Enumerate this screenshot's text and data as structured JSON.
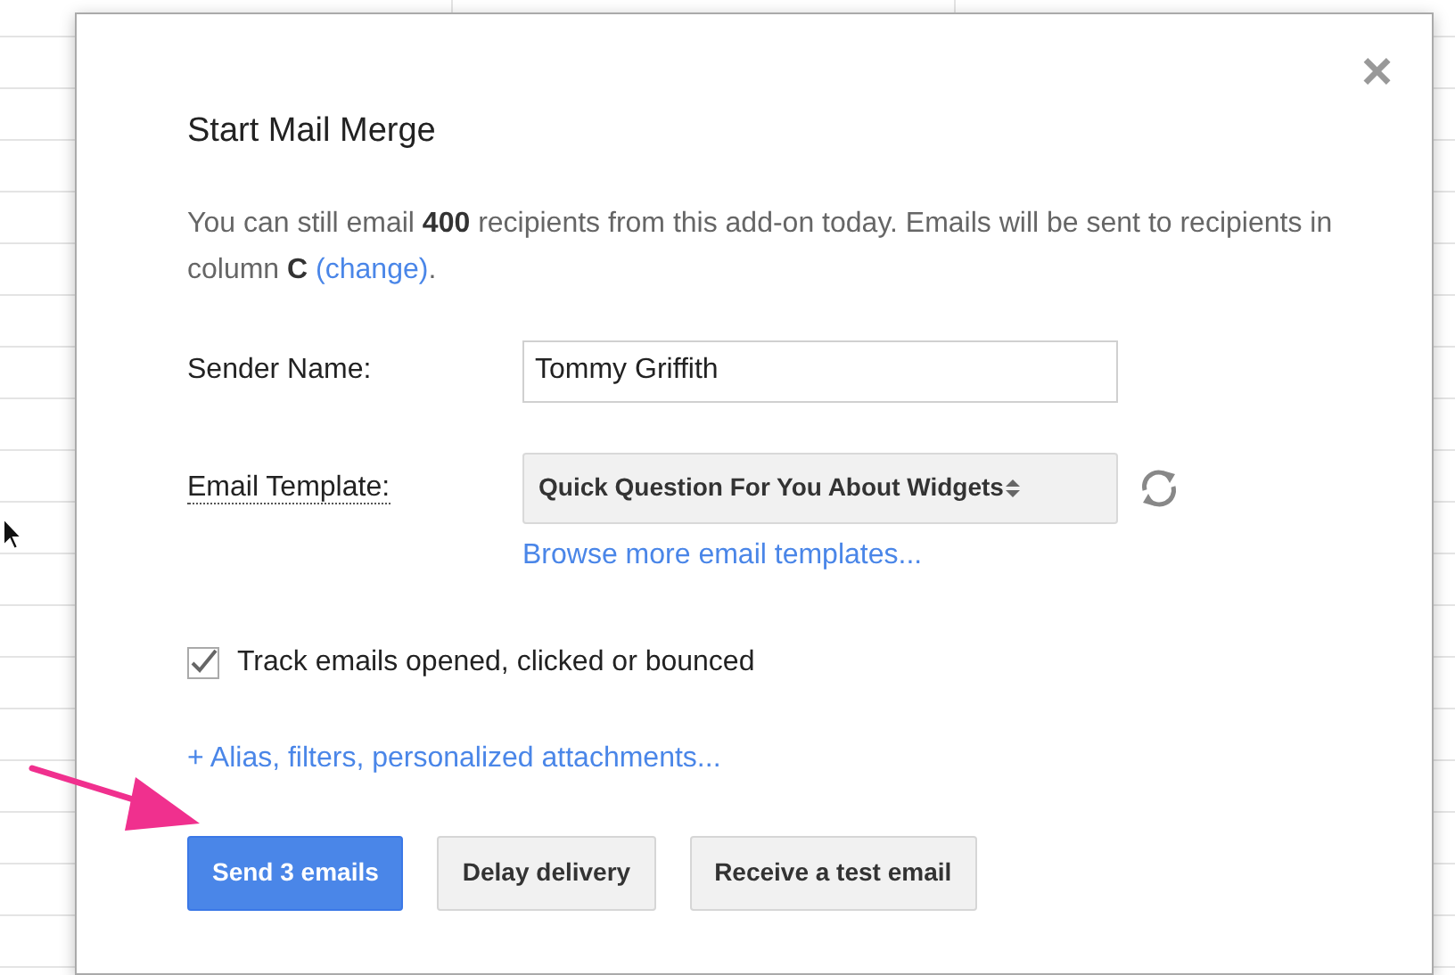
{
  "dialog": {
    "title": "Start Mail Merge",
    "close": "×",
    "notice": {
      "text": "You can still email **400** recipients from this add-on today. Emails will be sent to recipients in column **C** ",
      "link": "(change)",
      "after": "."
    },
    "sender": {
      "label": "Sender Name:",
      "value": "Tommy Griffith"
    },
    "template": {
      "label": "Email Template:",
      "value": "Quick Question For You About Widgets",
      "link": "Browse more email templates..."
    },
    "track": {
      "label": "Track emails opened, clicked or bounced",
      "checked": true
    },
    "options_link": "+ Alias, filters, personalized attachments...",
    "buttons": [
      {
        "label": "Send 3 emails",
        "primary": true
      },
      {
        "label": "Delay delivery",
        "primary": false
      },
      {
        "label": "Receive a test email",
        "primary": false
      }
    ]
  }
}
